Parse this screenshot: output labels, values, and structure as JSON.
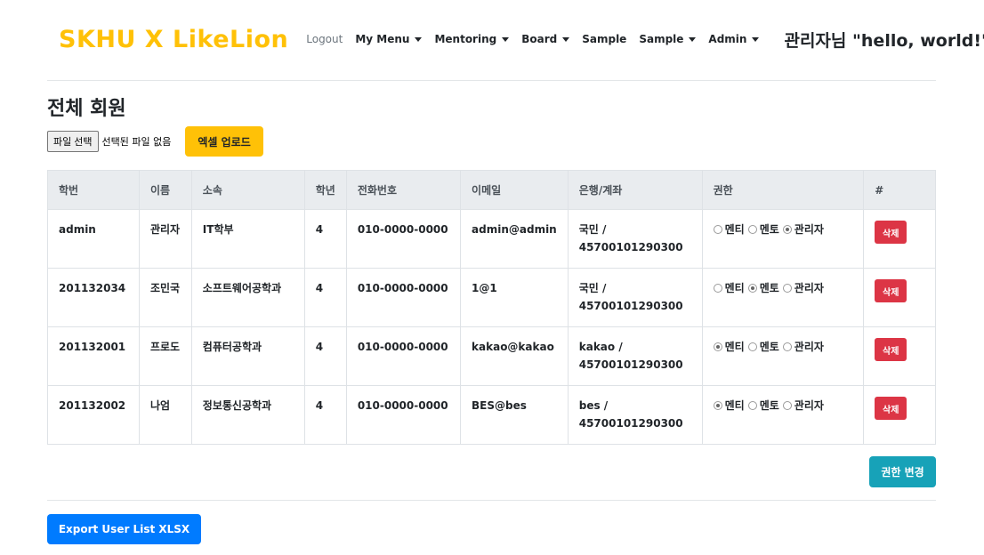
{
  "nav": {
    "brand": "SKHU X LikeLion",
    "logout": "Logout",
    "my_menu": "My Menu",
    "mentoring": "Mentoring",
    "board": "Board",
    "sample1": "Sample",
    "sample2": "Sample",
    "admin": "Admin",
    "greeting": "관리자님 \"hello, world!\""
  },
  "page": {
    "title": "전체 회원"
  },
  "upload": {
    "file_button": "파일 선택",
    "file_status": "선택된 파일 없음",
    "excel_button": "엑셀 업로드"
  },
  "table": {
    "headers": [
      "학번",
      "이름",
      "소속",
      "학년",
      "전화번호",
      "이메일",
      "은행/계좌",
      "권한",
      "#"
    ],
    "role_labels": [
      "멘티",
      "멘토",
      "관리자"
    ],
    "delete_label": "삭제",
    "rows": [
      {
        "id": "admin",
        "name": "관리자",
        "dept": "IT학부",
        "grade": "4",
        "phone": "010-0000-0000",
        "email": "admin@admin",
        "bank": "국민 /",
        "account": "45700101290300",
        "role": "관리자"
      },
      {
        "id": "201132034",
        "name": "조민국",
        "dept": "소프트웨어공학과",
        "grade": "4",
        "phone": "010-0000-0000",
        "email": "1@1",
        "bank": "국민 /",
        "account": "45700101290300",
        "role": "멘토"
      },
      {
        "id": "201132001",
        "name": "프로도",
        "dept": "컴퓨터공학과",
        "grade": "4",
        "phone": "010-0000-0000",
        "email": "kakao@kakao",
        "bank": "kakao /",
        "account": "45700101290300",
        "role": "멘티"
      },
      {
        "id": "201132002",
        "name": "나엄",
        "dept": "정보통신공학과",
        "grade": "4",
        "phone": "010-0000-0000",
        "email": "BES@bes",
        "bank": "bes /",
        "account": "45700101290300",
        "role": "멘티"
      }
    ]
  },
  "actions": {
    "change_role": "권한 변경",
    "export": "Export User List XLSX"
  },
  "colors": {
    "brand": "#ffc107",
    "danger": "#dc3545",
    "info": "#17a2b8",
    "primary": "#007bff"
  }
}
